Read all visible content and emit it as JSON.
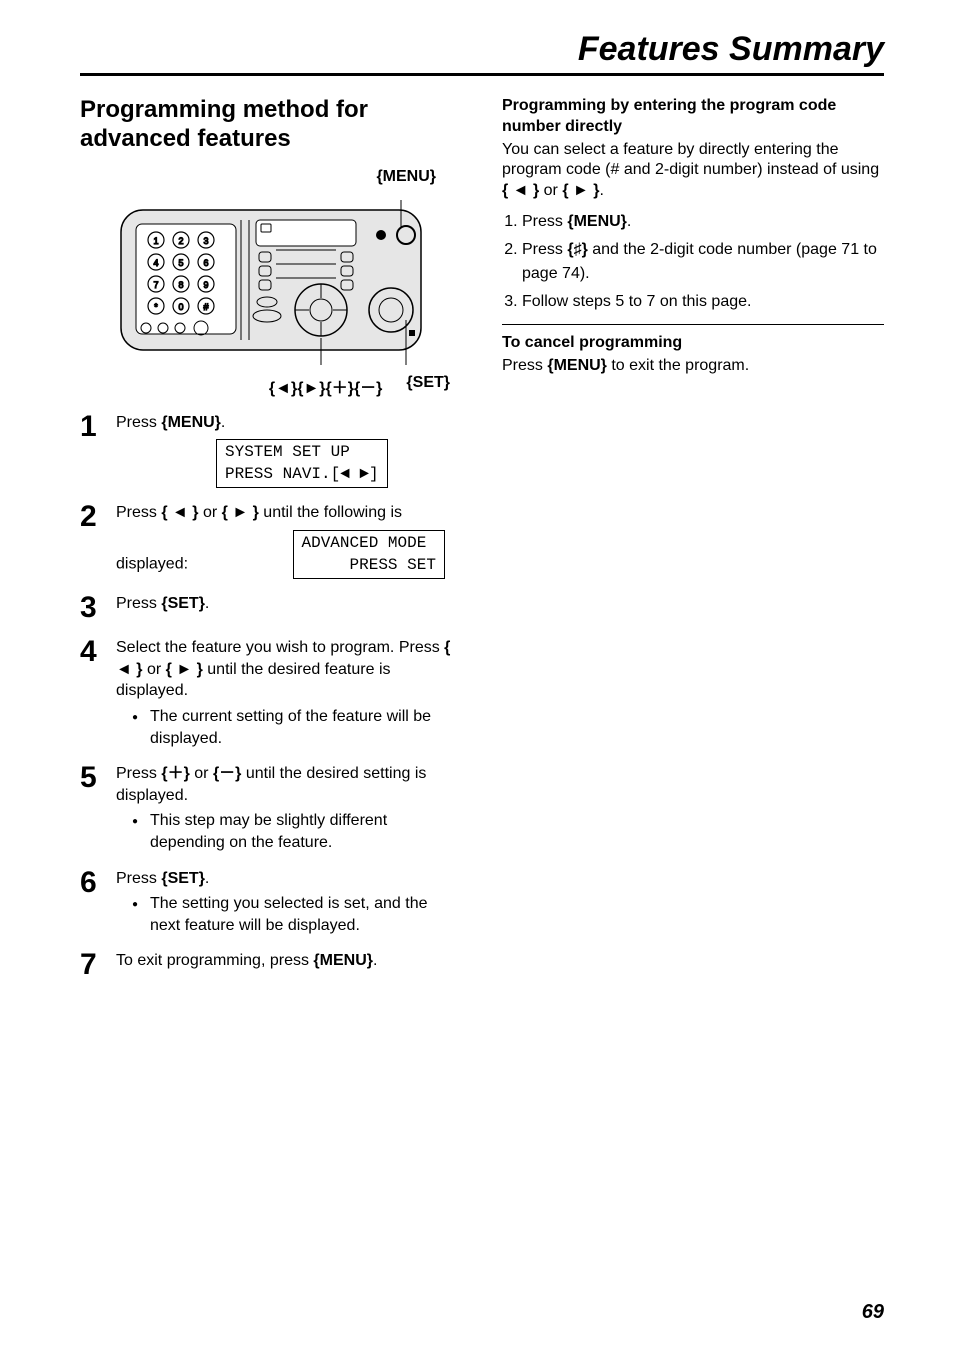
{
  "page_title": "Features Summary",
  "page_number": "69",
  "left": {
    "heading": "Programming method for advanced features",
    "menu_label": "{MENU}",
    "nav_label": "{◄}{►}{＋}{－}",
    "set_label": "{SET}",
    "lcd1": "SYSTEM SET UP\nPRESS NAVI.[◄ ►]",
    "lcd2": "ADVANCED MODE\n     PRESS SET",
    "steps": {
      "s1": {
        "num": "1",
        "t1": "Press ",
        "menu": "{MENU}",
        "t2": "."
      },
      "s2": {
        "num": "2",
        "t1": "Press ",
        "left": "{ ◄ }",
        "or": " or ",
        "right": "{ ► }",
        "t2": " until the following is displayed:"
      },
      "s3": {
        "num": "3",
        "t1": "Press ",
        "set": "{SET}",
        "t2": "."
      },
      "s4": {
        "num": "4",
        "t1": "Select the feature you wish to program. Press ",
        "left": "{ ◄ }",
        "or": " or ",
        "right": "{ ► }",
        "t2": " until the desired feature is displayed.",
        "bullet": "The current setting of the feature will be displayed."
      },
      "s5": {
        "num": "5",
        "t1": "Press ",
        "plus": "{＋}",
        "or": " or ",
        "minus": "{－}",
        "t2": " until the desired setting is displayed.",
        "bullet": "This step may be slightly different depending on the feature."
      },
      "s6": {
        "num": "6",
        "t1": "Press ",
        "set": "{SET}",
        "t2": ".",
        "bullet": "The setting you selected is set, and the next feature will be displayed."
      },
      "s7": {
        "num": "7",
        "t1": "To exit programming, press ",
        "menu": "{MENU}",
        "t2": "."
      }
    }
  },
  "right": {
    "subhead1": "Programming by entering the program code number directly",
    "para1a": "You can select a feature by directly entering the program code (# and 2-digit number) instead of using ",
    "left": "{ ◄ }",
    "or": " or ",
    "rightkey": "{ ► }",
    "para1b": ".",
    "list": {
      "i1a": "Press ",
      "i1menu": "{MENU}",
      "i1b": ".",
      "i2a": "Press ",
      "i2hash": "{♯}",
      "i2b": " and the 2-digit code number (page 71 to page 74).",
      "i3": "Follow steps 5 to 7 on this page."
    },
    "subhead2": "To cancel programming",
    "para2a": "Press ",
    "para2menu": "{MENU}",
    "para2b": " to exit the program."
  }
}
